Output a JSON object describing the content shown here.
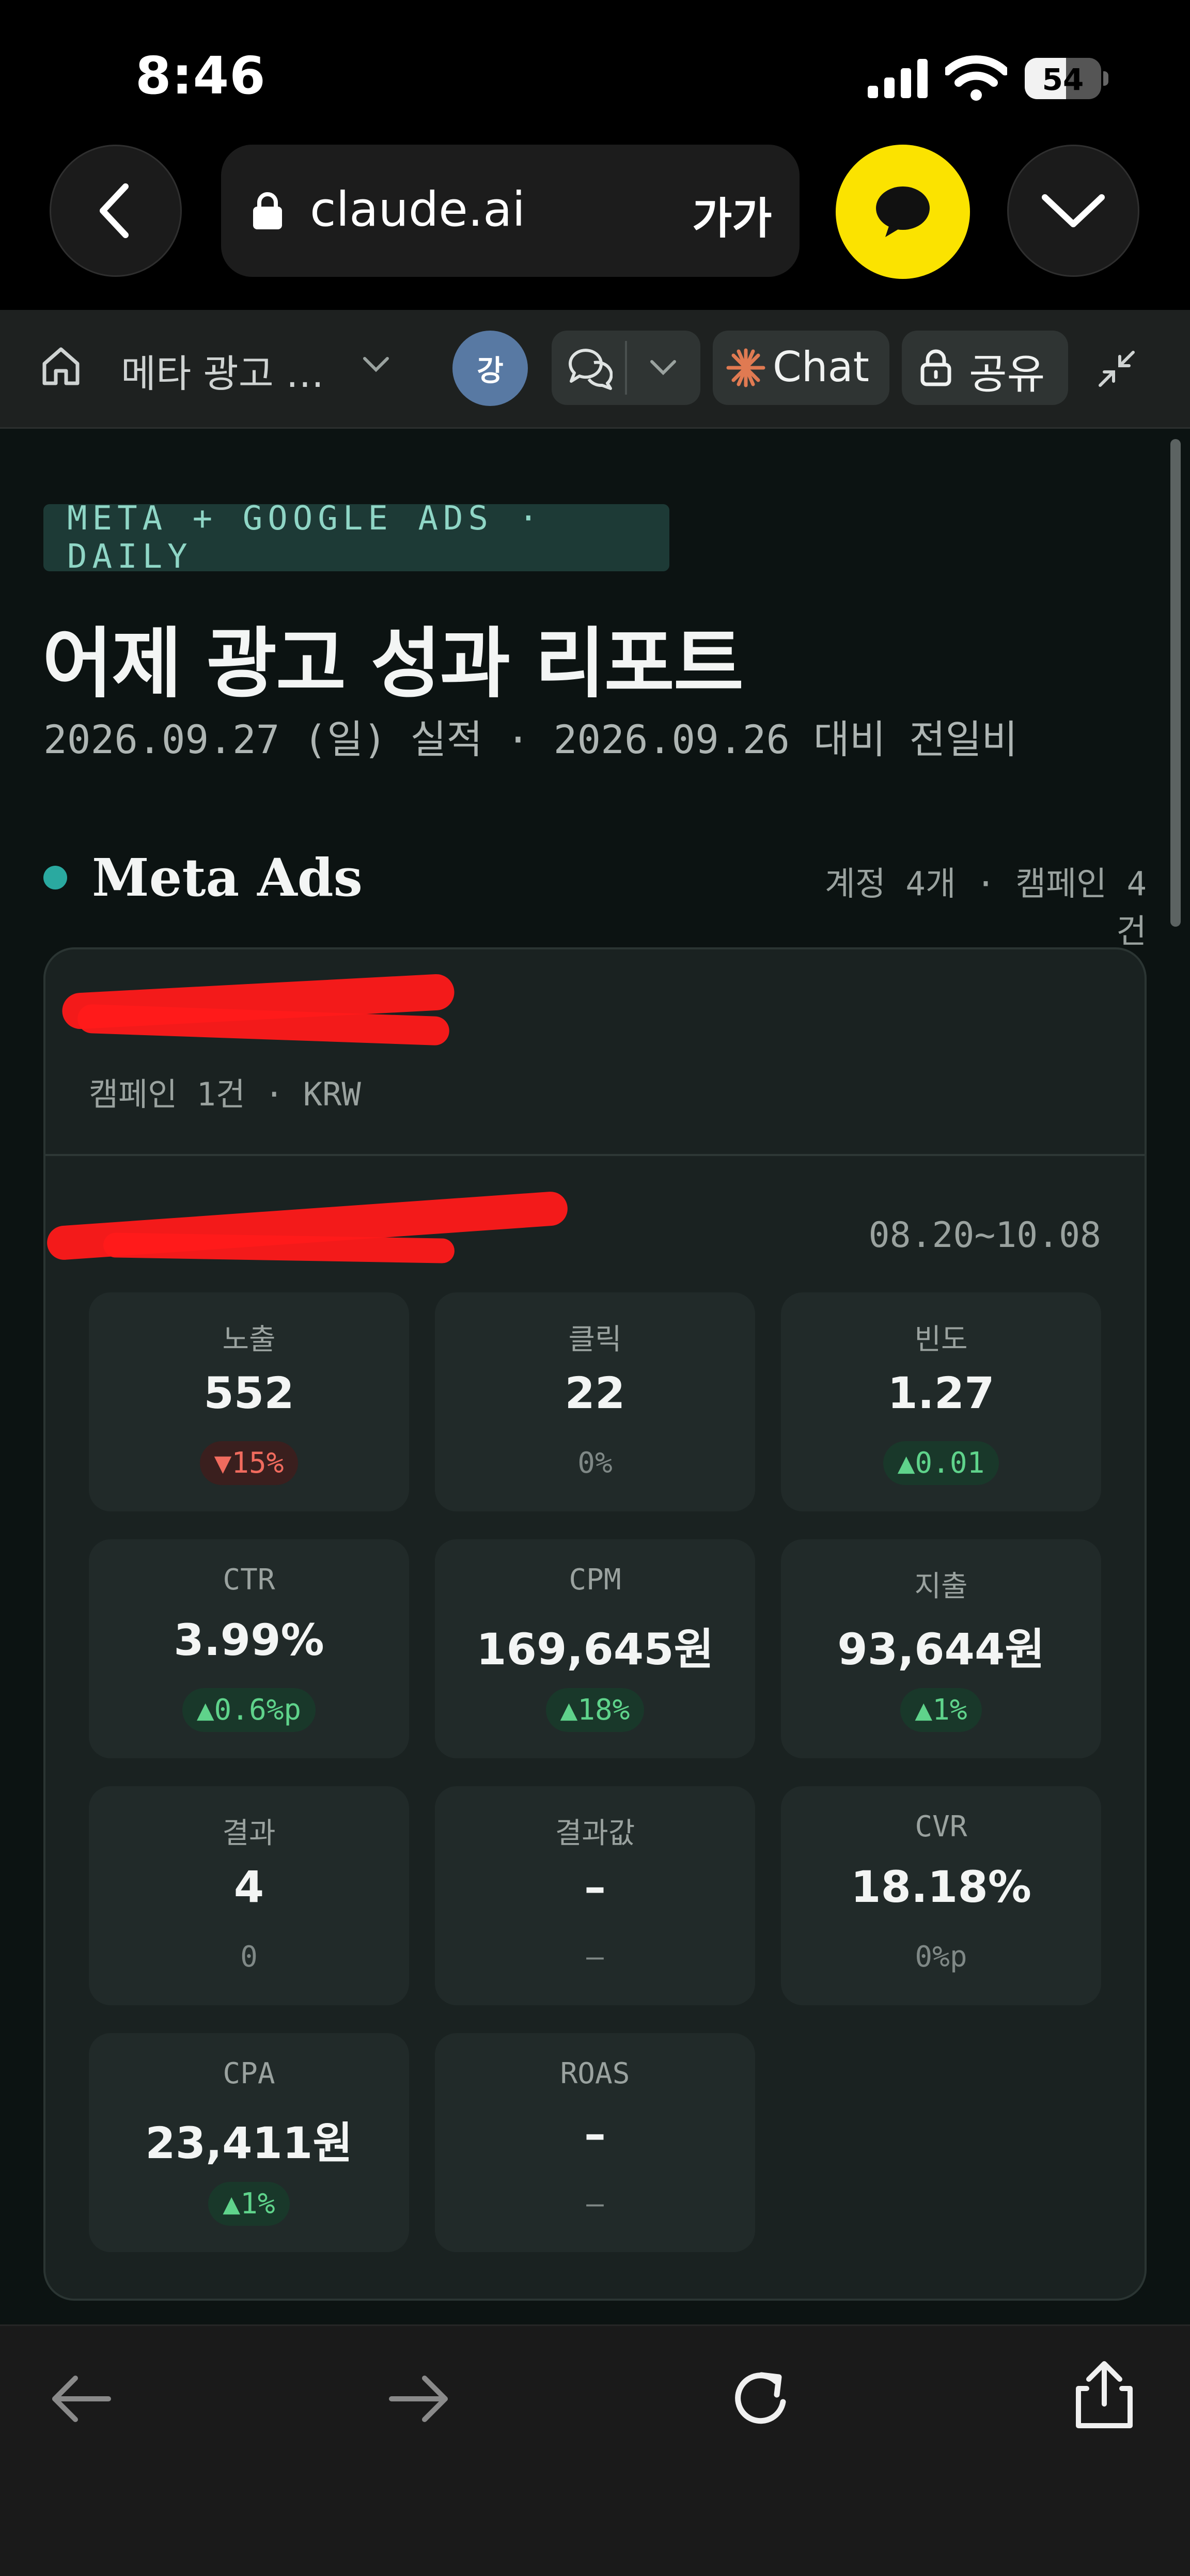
{
  "status_bar": {
    "time": "8:46",
    "battery": "54",
    "battery_level": 0.54
  },
  "browser": {
    "url": "claude.ai",
    "text_size_label": "가가"
  },
  "app_bar": {
    "project_title": "메타 광고 …",
    "avatar_initial": "강",
    "chat_label": "Chat",
    "share_label": "공유"
  },
  "report": {
    "badge": "META + GOOGLE ADS · DAILY",
    "title": "어제 광고 성과 리포트",
    "subtitle": "2026.09.27 (일) 실적 · 2026.09.26 대비 전일비"
  },
  "meta_section": {
    "title": "Meta Ads",
    "summary": "계정 4개 · 캠페인 4건",
    "account": {
      "name": "",
      "meta": "캠페인 1건 · KRW",
      "campaign": {
        "name": "",
        "date_range": "08.20~10.08",
        "metrics": [
          {
            "label": "노출",
            "value": "552",
            "change": "▼15%",
            "trend": "down"
          },
          {
            "label": "클릭",
            "value": "22",
            "change": "0%",
            "trend": "neutral"
          },
          {
            "label": "빈도",
            "value": "1.27",
            "change": "▲0.01",
            "trend": "up"
          },
          {
            "label": "CTR",
            "value": "3.99%",
            "change": "▲0.6%p",
            "trend": "up"
          },
          {
            "label": "CPM",
            "value": "169,645원",
            "change": "▲18%",
            "trend": "up"
          },
          {
            "label": "지출",
            "value": "93,644원",
            "change": "▲1%",
            "trend": "up"
          },
          {
            "label": "결과",
            "value": "4",
            "change": "0",
            "trend": "neutral"
          },
          {
            "label": "결과값",
            "value": "–",
            "change": "–",
            "trend": "neutral"
          },
          {
            "label": "CVR",
            "value": "18.18%",
            "change": "0%p",
            "trend": "neutral"
          },
          {
            "label": "CPA",
            "value": "23,411원",
            "change": "▲1%",
            "trend": "up"
          },
          {
            "label": "ROAS",
            "value": "–",
            "change": "–",
            "trend": "neutral"
          }
        ]
      }
    }
  },
  "colors": {
    "accent_teal": "#2aa9a0",
    "kakao_yellow": "#fbe300",
    "up": "#5fd38b",
    "down": "#f06b5e"
  }
}
